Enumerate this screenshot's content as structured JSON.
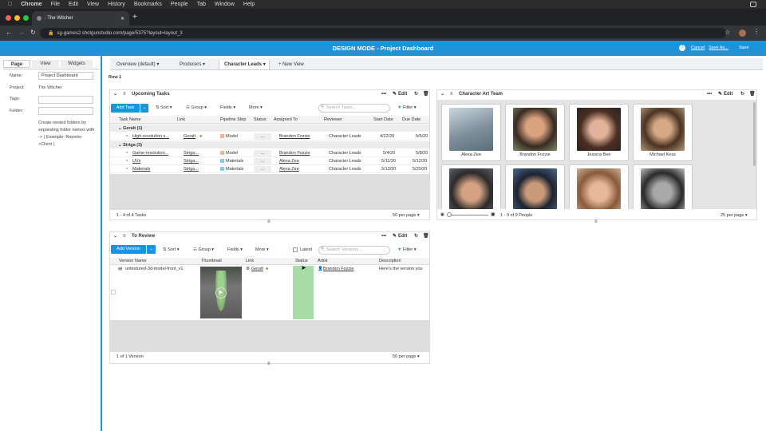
{
  "menubar": {
    "app": "Chrome",
    "items": [
      "File",
      "Edit",
      "View",
      "History",
      "Bookmarks",
      "People",
      "Tab",
      "Window",
      "Help"
    ]
  },
  "browser": {
    "tab_title": ": The Witcher",
    "url": "sg-games2.shotgunstudio.com/page/5375?layout=layout_3"
  },
  "header": {
    "title": "DESIGN MODE - Project Dashboard",
    "cancel": "Cancel",
    "save_as": "Save As...",
    "save": "Save"
  },
  "sidebar": {
    "tabs": [
      "Page",
      "View",
      "Widgets"
    ],
    "name_label": "Name:",
    "name_value": "Project Dashboard",
    "project_label": "Project:",
    "project_value": "The Witcher",
    "tags_label": "Tags:",
    "folder_label": "Folder:",
    "hint": "Create nested folders by separating folder names with -> ( Example: Reports->Client )"
  },
  "nav": {
    "tabs": [
      "Overview (default) ▾",
      "Producers ▾",
      "Character Leads ▾"
    ],
    "new_view": "+ New View",
    "row_label": "Row 1"
  },
  "tasks": {
    "title": "Upcoming Tasks",
    "edit": "Edit",
    "add": "Add Task",
    "sort": "Sort",
    "group": "Group",
    "fields": "Fields",
    "more": "More",
    "filter": "Filter",
    "search_placeholder": "Search Tasks...",
    "columns": [
      "Task Name",
      "Link",
      "Pipeline Step",
      "Status",
      "Assigned To",
      "Reviewer",
      "Start Date",
      "Due Date"
    ],
    "group1": "Geralt (1)",
    "group2": "Striga (3)",
    "rows": [
      {
        "name": "High-resolution s...",
        "link": "Geralt",
        "step": "Model",
        "status": "...",
        "assigned": "Brandon Fozzie",
        "reviewer": "Character Leads",
        "start": "4/22/20",
        "due": "5/5/20"
      },
      {
        "name": "Game-resolution...",
        "link": "Striga...",
        "step": "Model",
        "status": "...",
        "assigned": "Brandon Fozzie",
        "reviewer": "Character Leads",
        "start": "5/4/20",
        "due": "5/8/20"
      },
      {
        "name": "UVs",
        "link": "Striga...",
        "step": "Materials",
        "status": "...",
        "assigned": "Alexa Zee",
        "reviewer": "Character Leads",
        "start": "5/11/20",
        "due": "5/12/20"
      },
      {
        "name": "Materials",
        "link": "Striga...",
        "step": "Materials",
        "status": "...",
        "assigned": "Alexa Zee",
        "reviewer": "Character Leads",
        "start": "5/13/20",
        "due": "5/20/20"
      }
    ],
    "footer_count": "1 - 4 of 4 Tasks",
    "per_page": "50 per page ▾"
  },
  "team": {
    "title": "Character Art Team",
    "edit": "Edit",
    "people": [
      {
        "name": "Alexa Zee",
        "color": "#8a9aa8"
      },
      {
        "name": "Brandon Fozzie",
        "color": "#a3785a"
      },
      {
        "name": "Jessica Bee",
        "color": "#6b4a3a"
      },
      {
        "name": "Michael Kess",
        "color": "#7a6048"
      },
      {
        "name": "",
        "color": "#4c5563"
      },
      {
        "name": "",
        "color": "#3d4d66"
      },
      {
        "name": "",
        "color": "#9a7660"
      },
      {
        "name": "",
        "color": "#6d6d6d"
      }
    ],
    "footer_count": "1 - 9 of 9 People",
    "per_page": "25 per page ▾"
  },
  "review": {
    "title": "To Review",
    "edit": "Edit",
    "add": "Add Version",
    "sort": "Sort",
    "group": "Group",
    "fields": "Fields",
    "more": "More",
    "filter": "Filter",
    "latest": "Latest",
    "search_placeholder": "Search Versions...",
    "columns": [
      "Version Name",
      "Thumbnail",
      "Link",
      "Status",
      "Artist",
      "Description"
    ],
    "row": {
      "name": "untextured-3d-model-front_v1",
      "link": "Geralt",
      "artist": "Brandon Fozzie",
      "description": "Here's the version you"
    },
    "footer_count": "1 of 1 Version",
    "per_page": "50 per page ▾"
  }
}
